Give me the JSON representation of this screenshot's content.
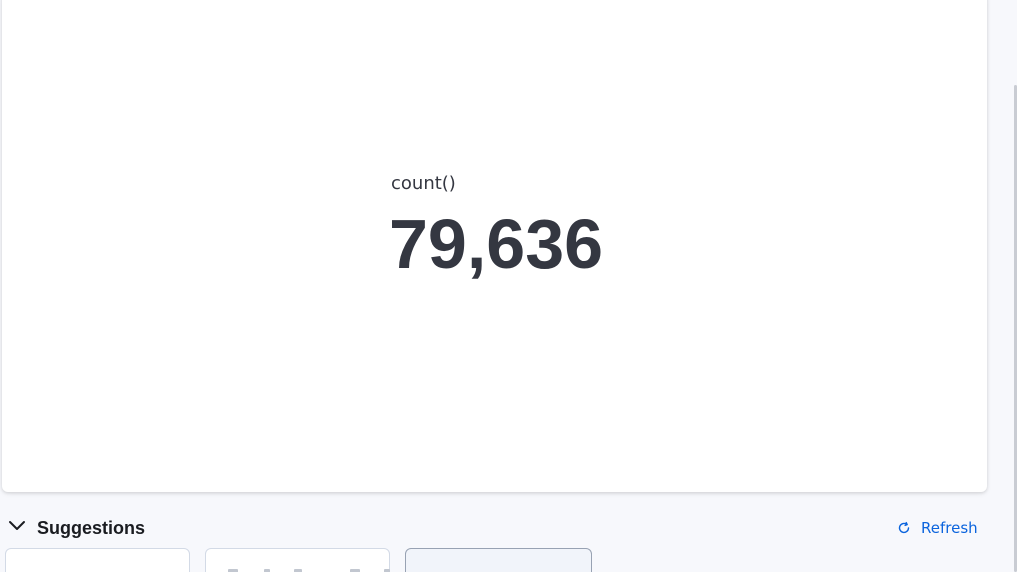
{
  "metric": {
    "label": "count()",
    "value": "79,636"
  },
  "suggestions": {
    "title": "Suggestions",
    "toggle_icon": "chevron-down-icon",
    "refresh_label": "Refresh",
    "refresh_icon": "refresh-icon",
    "cards_count_visible": 3
  },
  "colors": {
    "background": "#f7f8fc",
    "panel": "#ffffff",
    "text_primary": "#343741",
    "link": "#0b64dd"
  }
}
